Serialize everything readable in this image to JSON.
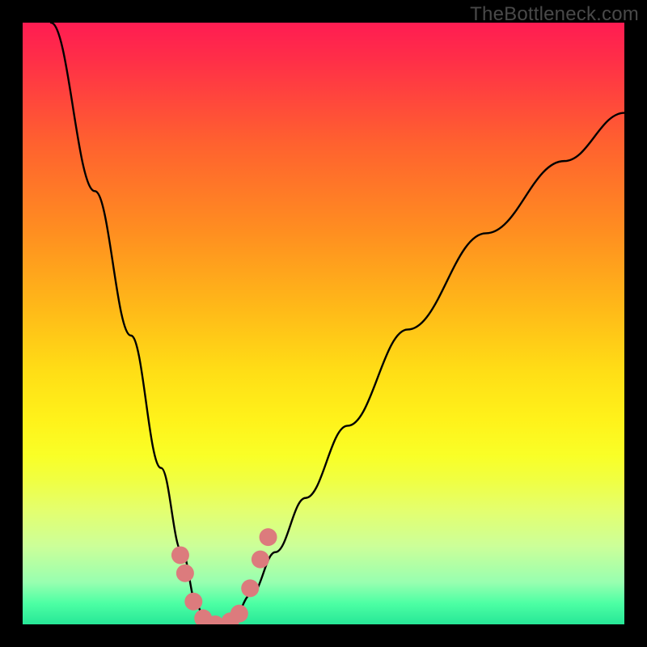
{
  "watermark": "TheBottleneck.com",
  "chart_data": {
    "type": "line",
    "title": "",
    "xlabel": "",
    "ylabel": "",
    "xlim": [
      0,
      1
    ],
    "ylim": [
      0,
      1
    ],
    "gradient_stops": [
      {
        "offset": 0.0,
        "color": "#FF1C52"
      },
      {
        "offset": 0.06,
        "color": "#FF2E48"
      },
      {
        "offset": 0.2,
        "color": "#FF612F"
      },
      {
        "offset": 0.35,
        "color": "#FF8F20"
      },
      {
        "offset": 0.48,
        "color": "#FFBB18"
      },
      {
        "offset": 0.58,
        "color": "#FFDE16"
      },
      {
        "offset": 0.66,
        "color": "#FFF21A"
      },
      {
        "offset": 0.72,
        "color": "#F9FF27"
      },
      {
        "offset": 0.76,
        "color": "#F0FF42"
      },
      {
        "offset": 0.81,
        "color": "#E4FF6E"
      },
      {
        "offset": 0.87,
        "color": "#CCFF99"
      },
      {
        "offset": 0.93,
        "color": "#98FFB0"
      },
      {
        "offset": 0.965,
        "color": "#4DFFA4"
      },
      {
        "offset": 1.0,
        "color": "#27E797"
      }
    ],
    "series": [
      {
        "name": "bottleneck-curve",
        "x": [
          0.047,
          0.12,
          0.18,
          0.23,
          0.265,
          0.29,
          0.305,
          0.32,
          0.335,
          0.35,
          0.38,
          0.42,
          0.47,
          0.54,
          0.64,
          0.77,
          0.9,
          1.0
        ],
        "y": [
          1.0,
          0.72,
          0.48,
          0.26,
          0.12,
          0.03,
          0.0,
          0.0,
          0.0,
          0.01,
          0.05,
          0.12,
          0.21,
          0.33,
          0.49,
          0.65,
          0.77,
          0.85
        ]
      }
    ],
    "highlight_region": {
      "color": "#DC7B7D",
      "points_x": [
        0.262,
        0.27,
        0.284,
        0.3,
        0.32,
        0.345,
        0.36,
        0.378,
        0.395,
        0.408
      ],
      "points_y": [
        0.115,
        0.085,
        0.038,
        0.01,
        0.0,
        0.005,
        0.018,
        0.06,
        0.108,
        0.145
      ]
    }
  }
}
